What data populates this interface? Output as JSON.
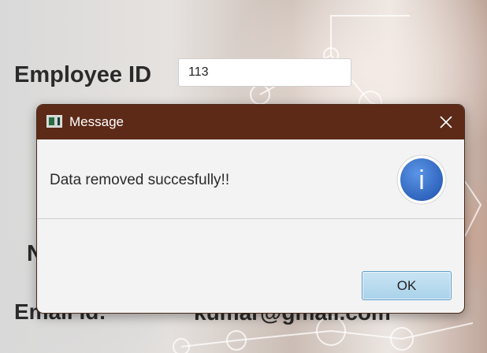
{
  "form": {
    "employee_id_label": "Employee ID",
    "employee_id_value": "113",
    "partial_label": "N",
    "email_label": "Email Id:",
    "email_value": "kumar@gmail.com"
  },
  "dialog": {
    "title": "Message",
    "message": "Data removed succesfully!!",
    "ok_label": "OK",
    "close_icon": "close-icon",
    "info_icon": "info-icon",
    "info_glyph": "i",
    "titlebar_color": "#5c2a17",
    "info_color": "#2f6fd0"
  }
}
